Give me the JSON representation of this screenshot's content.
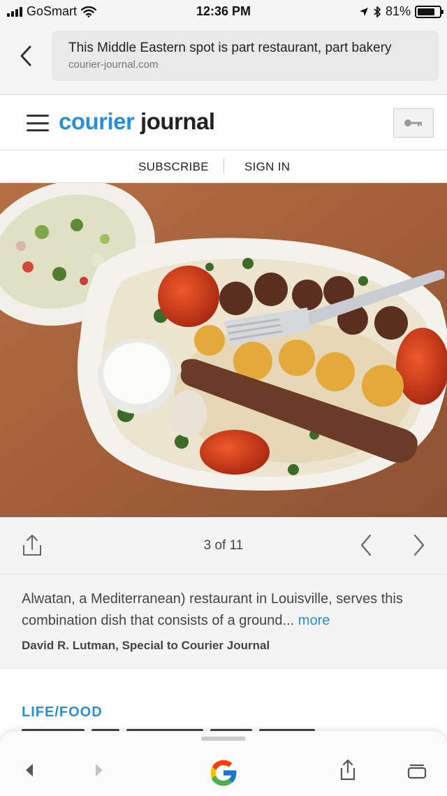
{
  "status_bar": {
    "carrier": "GoSmart",
    "time": "12:36 PM",
    "battery_percent": "81%",
    "battery_level": 0.81,
    "icons": [
      "signal-bars-icon",
      "wifi-icon",
      "location-arrow-icon",
      "bluetooth-icon",
      "battery-icon"
    ]
  },
  "url_bar": {
    "page_title": "This Middle Eastern spot is part restaurant, part bakery",
    "host": "courier-journal.com",
    "back_icon": "chevron-left-icon"
  },
  "site_header": {
    "logo_part1": "courier",
    "logo_part2": "journal",
    "menu_icon": "hamburger-menu-icon",
    "login_icon": "key-icon",
    "brand_color": "#2b8fd1"
  },
  "subscribe_bar": {
    "subscribe": "SUBSCRIBE",
    "sign_in": "SIGN IN"
  },
  "gallery": {
    "counter": "3 of 11",
    "share_icon": "share-icon",
    "prev_icon": "chevron-left-icon",
    "next_icon": "chevron-right-icon"
  },
  "caption": {
    "text": "Alwatan, a Mediterranean) restaurant in Louisville, serves this combination dish that consists of a ground...",
    "more": "more",
    "credit": "David R. Lutman, Special to Courier Journal"
  },
  "section": {
    "label": "LIFE/FOOD"
  },
  "browser_toolbar": {
    "icons": [
      "back-arrow-icon",
      "forward-arrow-icon",
      "google-g-icon",
      "share-icon",
      "tabs-icon"
    ]
  }
}
